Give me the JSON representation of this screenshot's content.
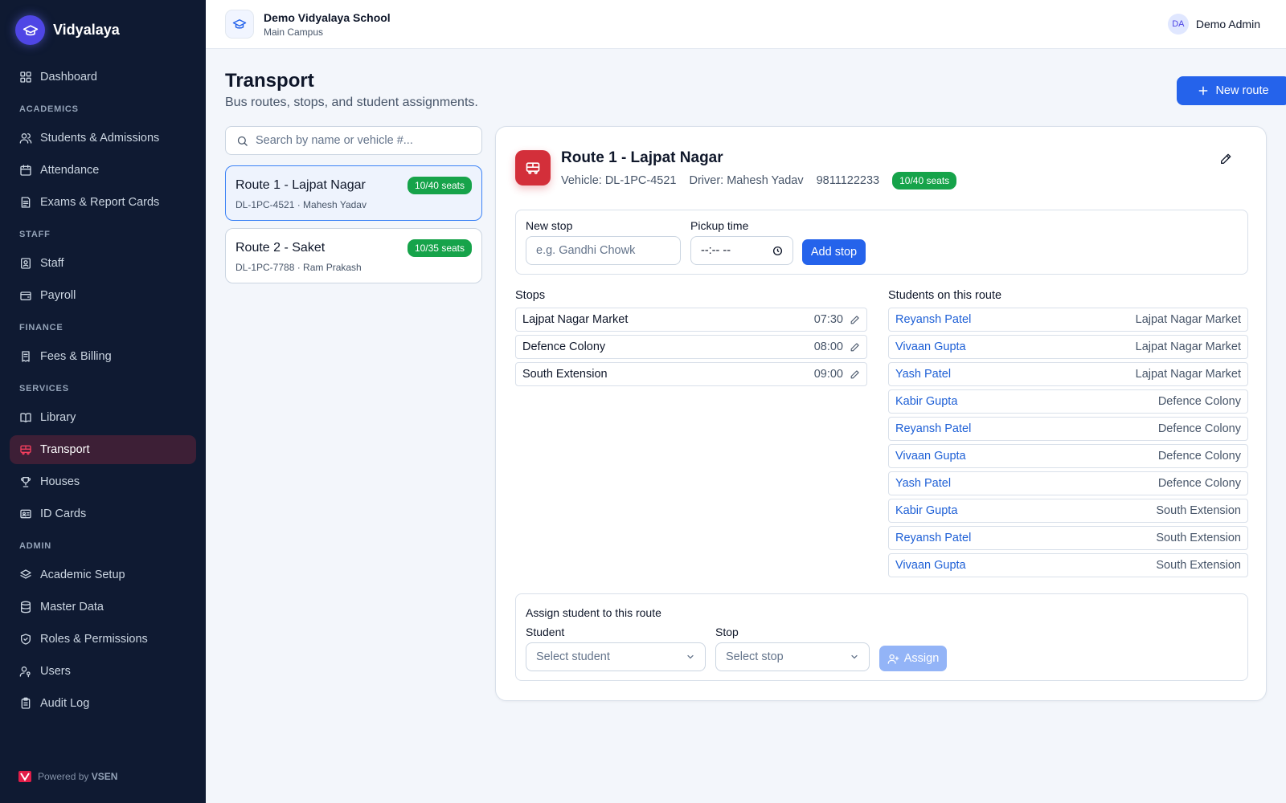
{
  "sidebar": {
    "brand": "Vidyalaya",
    "items": [
      {
        "type": "item",
        "label": "Dashboard",
        "icon": "dashboard-icon"
      },
      {
        "type": "section",
        "label": "ACADEMICS"
      },
      {
        "type": "item",
        "label": "Students & Admissions",
        "icon": "users-icon"
      },
      {
        "type": "item",
        "label": "Attendance",
        "icon": "calendar-icon"
      },
      {
        "type": "item",
        "label": "Exams & Report Cards",
        "icon": "report-icon"
      },
      {
        "type": "section",
        "label": "STAFF"
      },
      {
        "type": "item",
        "label": "Staff",
        "icon": "id-badge-icon"
      },
      {
        "type": "item",
        "label": "Payroll",
        "icon": "wallet-icon"
      },
      {
        "type": "section",
        "label": "FINANCE"
      },
      {
        "type": "item",
        "label": "Fees & Billing",
        "icon": "receipt-icon"
      },
      {
        "type": "section",
        "label": "SERVICES"
      },
      {
        "type": "item",
        "label": "Library",
        "icon": "book-icon"
      },
      {
        "type": "item",
        "label": "Transport",
        "icon": "bus-icon",
        "active": true
      },
      {
        "type": "item",
        "label": "Houses",
        "icon": "trophy-icon"
      },
      {
        "type": "item",
        "label": "ID Cards",
        "icon": "id-card-icon"
      },
      {
        "type": "section",
        "label": "ADMIN"
      },
      {
        "type": "item",
        "label": "Academic Setup",
        "icon": "layers-icon"
      },
      {
        "type": "item",
        "label": "Master Data",
        "icon": "database-icon"
      },
      {
        "type": "item",
        "label": "Roles & Permissions",
        "icon": "shield-icon"
      },
      {
        "type": "item",
        "label": "Users",
        "icon": "user-key-icon"
      },
      {
        "type": "item",
        "label": "Audit Log",
        "icon": "clipboard-icon"
      }
    ],
    "powered_prefix": "Powered by",
    "powered_brand": "VSEN"
  },
  "topbar": {
    "school_name": "Demo Vidyalaya School",
    "campus": "Main Campus",
    "user_initials": "DA",
    "user_name": "Demo Admin"
  },
  "page": {
    "title": "Transport",
    "subtitle": "Bus routes, stops, and student assignments.",
    "new_route_label": "New route"
  },
  "search": {
    "placeholder": "Search by name or vehicle #..."
  },
  "routes": [
    {
      "name": "Route 1 - Lajpat Nagar",
      "sub": "DL-1PC-4521 · Mahesh Yadav",
      "seats": "10/40 seats"
    },
    {
      "name": "Route 2 - Saket",
      "sub": "DL-1PC-7788 · Ram Prakash",
      "seats": "10/35 seats"
    }
  ],
  "detail": {
    "title": "Route 1 - Lajpat Nagar",
    "vehicle": "Vehicle: DL-1PC-4521",
    "driver": "Driver: Mahesh Yadav",
    "phone": "9811122233",
    "seats": "10/40 seats",
    "new_stop_label": "New stop",
    "new_stop_placeholder": "e.g. Gandhi Chowk",
    "pickup_label": "Pickup time",
    "pickup_value": "--:-- --",
    "add_stop_label": "Add stop",
    "stops_title": "Stops",
    "stops": [
      {
        "name": "Lajpat Nagar Market",
        "time": "07:30"
      },
      {
        "name": "Defence Colony",
        "time": "08:00"
      },
      {
        "name": "South Extension",
        "time": "09:00"
      }
    ],
    "students_title": "Students on this route",
    "students": [
      {
        "name": "Reyansh Patel",
        "stop": "Lajpat Nagar Market"
      },
      {
        "name": "Vivaan Gupta",
        "stop": "Lajpat Nagar Market"
      },
      {
        "name": "Yash Patel",
        "stop": "Lajpat Nagar Market"
      },
      {
        "name": "Kabir Gupta",
        "stop": "Defence Colony"
      },
      {
        "name": "Reyansh Patel",
        "stop": "Defence Colony"
      },
      {
        "name": "Vivaan Gupta",
        "stop": "Defence Colony"
      },
      {
        "name": "Yash Patel",
        "stop": "Defence Colony"
      },
      {
        "name": "Kabir Gupta",
        "stop": "South Extension"
      },
      {
        "name": "Reyansh Patel",
        "stop": "South Extension"
      },
      {
        "name": "Vivaan Gupta",
        "stop": "South Extension"
      }
    ],
    "assign_title": "Assign student to this route",
    "student_label": "Student",
    "student_placeholder": "Select student",
    "stop_label": "Stop",
    "stop_placeholder": "Select stop",
    "assign_label": "Assign"
  },
  "colors": {
    "accent": "#2563eb",
    "badge": "#16a34a",
    "sidebar_bg": "#0f1a32",
    "active_bg": "#3d1f36",
    "bus": "#d32f3a"
  }
}
